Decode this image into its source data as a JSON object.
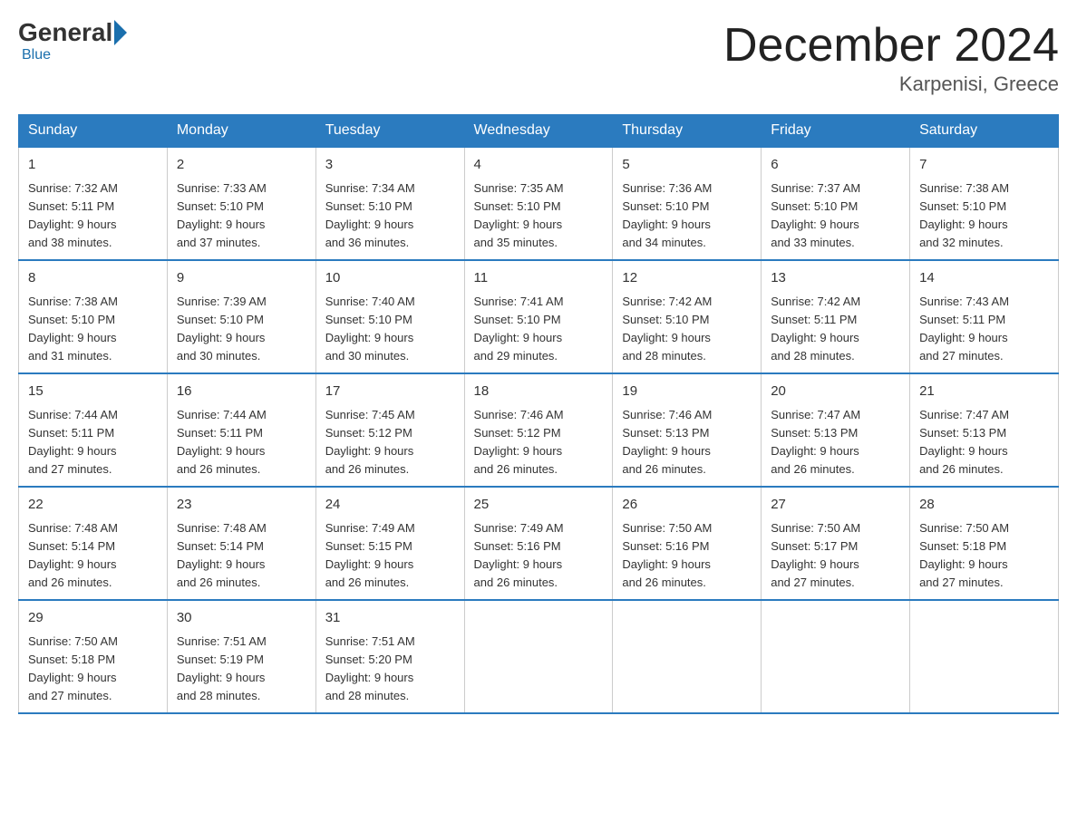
{
  "header": {
    "logo_general": "General",
    "logo_blue": "Blue",
    "month_title": "December 2024",
    "location": "Karpenisi, Greece"
  },
  "days_of_week": [
    "Sunday",
    "Monday",
    "Tuesday",
    "Wednesday",
    "Thursday",
    "Friday",
    "Saturday"
  ],
  "weeks": [
    [
      {
        "day": "1",
        "info": "Sunrise: 7:32 AM\nSunset: 5:11 PM\nDaylight: 9 hours\nand 38 minutes."
      },
      {
        "day": "2",
        "info": "Sunrise: 7:33 AM\nSunset: 5:10 PM\nDaylight: 9 hours\nand 37 minutes."
      },
      {
        "day": "3",
        "info": "Sunrise: 7:34 AM\nSunset: 5:10 PM\nDaylight: 9 hours\nand 36 minutes."
      },
      {
        "day": "4",
        "info": "Sunrise: 7:35 AM\nSunset: 5:10 PM\nDaylight: 9 hours\nand 35 minutes."
      },
      {
        "day": "5",
        "info": "Sunrise: 7:36 AM\nSunset: 5:10 PM\nDaylight: 9 hours\nand 34 minutes."
      },
      {
        "day": "6",
        "info": "Sunrise: 7:37 AM\nSunset: 5:10 PM\nDaylight: 9 hours\nand 33 minutes."
      },
      {
        "day": "7",
        "info": "Sunrise: 7:38 AM\nSunset: 5:10 PM\nDaylight: 9 hours\nand 32 minutes."
      }
    ],
    [
      {
        "day": "8",
        "info": "Sunrise: 7:38 AM\nSunset: 5:10 PM\nDaylight: 9 hours\nand 31 minutes."
      },
      {
        "day": "9",
        "info": "Sunrise: 7:39 AM\nSunset: 5:10 PM\nDaylight: 9 hours\nand 30 minutes."
      },
      {
        "day": "10",
        "info": "Sunrise: 7:40 AM\nSunset: 5:10 PM\nDaylight: 9 hours\nand 30 minutes."
      },
      {
        "day": "11",
        "info": "Sunrise: 7:41 AM\nSunset: 5:10 PM\nDaylight: 9 hours\nand 29 minutes."
      },
      {
        "day": "12",
        "info": "Sunrise: 7:42 AM\nSunset: 5:10 PM\nDaylight: 9 hours\nand 28 minutes."
      },
      {
        "day": "13",
        "info": "Sunrise: 7:42 AM\nSunset: 5:11 PM\nDaylight: 9 hours\nand 28 minutes."
      },
      {
        "day": "14",
        "info": "Sunrise: 7:43 AM\nSunset: 5:11 PM\nDaylight: 9 hours\nand 27 minutes."
      }
    ],
    [
      {
        "day": "15",
        "info": "Sunrise: 7:44 AM\nSunset: 5:11 PM\nDaylight: 9 hours\nand 27 minutes."
      },
      {
        "day": "16",
        "info": "Sunrise: 7:44 AM\nSunset: 5:11 PM\nDaylight: 9 hours\nand 26 minutes."
      },
      {
        "day": "17",
        "info": "Sunrise: 7:45 AM\nSunset: 5:12 PM\nDaylight: 9 hours\nand 26 minutes."
      },
      {
        "day": "18",
        "info": "Sunrise: 7:46 AM\nSunset: 5:12 PM\nDaylight: 9 hours\nand 26 minutes."
      },
      {
        "day": "19",
        "info": "Sunrise: 7:46 AM\nSunset: 5:13 PM\nDaylight: 9 hours\nand 26 minutes."
      },
      {
        "day": "20",
        "info": "Sunrise: 7:47 AM\nSunset: 5:13 PM\nDaylight: 9 hours\nand 26 minutes."
      },
      {
        "day": "21",
        "info": "Sunrise: 7:47 AM\nSunset: 5:13 PM\nDaylight: 9 hours\nand 26 minutes."
      }
    ],
    [
      {
        "day": "22",
        "info": "Sunrise: 7:48 AM\nSunset: 5:14 PM\nDaylight: 9 hours\nand 26 minutes."
      },
      {
        "day": "23",
        "info": "Sunrise: 7:48 AM\nSunset: 5:14 PM\nDaylight: 9 hours\nand 26 minutes."
      },
      {
        "day": "24",
        "info": "Sunrise: 7:49 AM\nSunset: 5:15 PM\nDaylight: 9 hours\nand 26 minutes."
      },
      {
        "day": "25",
        "info": "Sunrise: 7:49 AM\nSunset: 5:16 PM\nDaylight: 9 hours\nand 26 minutes."
      },
      {
        "day": "26",
        "info": "Sunrise: 7:50 AM\nSunset: 5:16 PM\nDaylight: 9 hours\nand 26 minutes."
      },
      {
        "day": "27",
        "info": "Sunrise: 7:50 AM\nSunset: 5:17 PM\nDaylight: 9 hours\nand 27 minutes."
      },
      {
        "day": "28",
        "info": "Sunrise: 7:50 AM\nSunset: 5:18 PM\nDaylight: 9 hours\nand 27 minutes."
      }
    ],
    [
      {
        "day": "29",
        "info": "Sunrise: 7:50 AM\nSunset: 5:18 PM\nDaylight: 9 hours\nand 27 minutes."
      },
      {
        "day": "30",
        "info": "Sunrise: 7:51 AM\nSunset: 5:19 PM\nDaylight: 9 hours\nand 28 minutes."
      },
      {
        "day": "31",
        "info": "Sunrise: 7:51 AM\nSunset: 5:20 PM\nDaylight: 9 hours\nand 28 minutes."
      },
      null,
      null,
      null,
      null
    ]
  ]
}
